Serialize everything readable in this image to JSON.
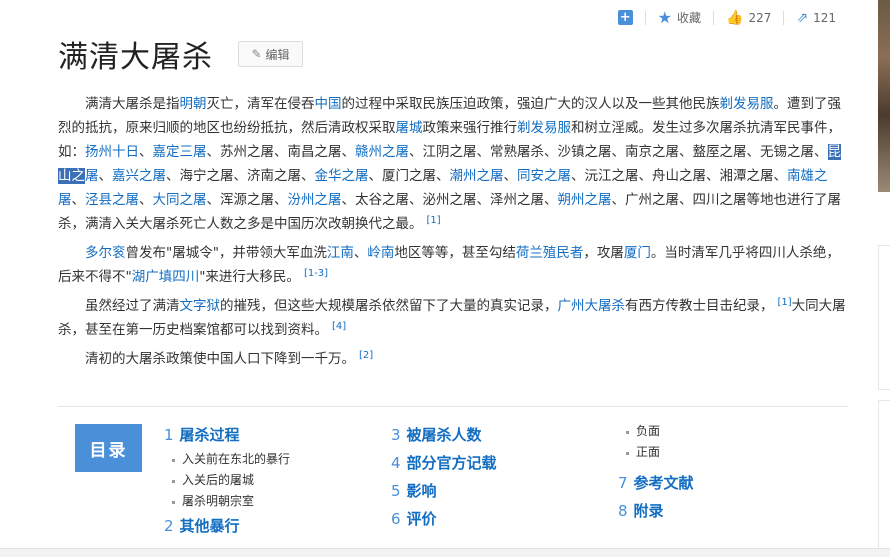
{
  "topbar": {
    "collect_label": "收藏",
    "like_count": "227",
    "share_count": "121"
  },
  "page": {
    "title": "满清大屠杀",
    "edit_label": "编辑"
  },
  "content": {
    "p1": [
      {
        "t": "满清大屠杀是指"
      },
      {
        "t": "明朝",
        "link": true
      },
      {
        "t": "灭亡，清军在侵吞"
      },
      {
        "t": "中国",
        "link": true
      },
      {
        "t": "的过程中采取民族压迫政策，强迫广大的汉人以及一些其他民族"
      },
      {
        "t": "剃发易服",
        "link": true
      },
      {
        "t": "。遭到了强烈的抵抗，原来归顺的地区也纷纷抵抗，然后清政权采取"
      },
      {
        "t": "屠城",
        "link": true
      },
      {
        "t": "政策来强行推行"
      },
      {
        "t": "剃发易服",
        "link": true
      },
      {
        "t": "和树立淫威。发生过多次屠杀抗清军民事件，如："
      },
      {
        "t": "扬州十日",
        "link": true
      },
      {
        "t": "、"
      },
      {
        "t": "嘉定三屠",
        "link": true
      },
      {
        "t": "、苏州之屠、南昌之屠、"
      },
      {
        "t": "赣州之屠",
        "link": true
      },
      {
        "t": "、江阴之屠、常熟屠杀、沙镇之屠、南京之屠、盩厔之屠、无锡之屠、"
      },
      {
        "t": "昆山之",
        "link": true,
        "hl": true
      },
      {
        "t": "屠",
        "link": true
      },
      {
        "t": "、"
      },
      {
        "t": "嘉兴之屠",
        "link": true
      },
      {
        "t": "、海宁之屠、济南之屠、"
      },
      {
        "t": "金华之屠",
        "link": true
      },
      {
        "t": "、厦门之屠、"
      },
      {
        "t": "潮州之屠",
        "link": true
      },
      {
        "t": "、"
      },
      {
        "t": "同安之屠",
        "link": true
      },
      {
        "t": "、沅江之屠、舟山之屠、湘潭之屠、"
      },
      {
        "t": "南雄之屠",
        "link": true
      },
      {
        "t": "、"
      },
      {
        "t": "泾县之屠",
        "link": true
      },
      {
        "t": "、"
      },
      {
        "t": "大同之屠",
        "link": true
      },
      {
        "t": "、浑源之屠、"
      },
      {
        "t": "汾州之屠",
        "link": true
      },
      {
        "t": "、太谷之屠、泌州之屠、泽州之屠、"
      },
      {
        "t": "朔州之屠",
        "link": true
      },
      {
        "t": "、广州之屠、四川之屠等地也进行了屠杀，满清入关大屠杀死亡人数之多是中国历次改朝换代之最。"
      },
      {
        "t": "[1]",
        "sup": true
      }
    ],
    "p2": [
      {
        "t": "多尔衮",
        "link": true
      },
      {
        "t": "曾发布\"屠城令\"，并带领大军血洗"
      },
      {
        "t": "江南",
        "link": true
      },
      {
        "t": "、"
      },
      {
        "t": "岭南",
        "link": true
      },
      {
        "t": "地区等等，甚至勾结"
      },
      {
        "t": "荷兰殖民者",
        "link": true
      },
      {
        "t": "，攻屠"
      },
      {
        "t": "厦门",
        "link": true
      },
      {
        "t": "。当时清军几乎将四川人杀绝，后来不得不\""
      },
      {
        "t": "湖广填四川",
        "link": true
      },
      {
        "t": "\"来进行大移民。"
      },
      {
        "t": "[1-3]",
        "sup": true
      }
    ],
    "p3": [
      {
        "t": "虽然经过了满清"
      },
      {
        "t": "文字狱",
        "link": true
      },
      {
        "t": "的摧残，但这些大规模屠杀依然留下了大量的真实记录，"
      },
      {
        "t": "广州大屠杀",
        "link": true
      },
      {
        "t": "有西方传教士目击纪录，"
      },
      {
        "t": "[1]",
        "sup": true
      },
      {
        "t": "大同大屠杀，甚至在第一历史档案馆都可以找到资料。"
      },
      {
        "t": "[4]",
        "sup": true
      }
    ],
    "p4": [
      {
        "t": "清初的大屠杀政策使中国人口下降到一千万。"
      },
      {
        "t": "[2]",
        "sup": true
      }
    ]
  },
  "toc": {
    "label": "目录",
    "col1": [
      {
        "num": "1",
        "label": "屠杀过程",
        "children": [
          "入关前在东北的暴行",
          "入关后的屠城",
          "屠杀明朝宗室"
        ]
      },
      {
        "num": "2",
        "label": "其他暴行",
        "children": []
      }
    ],
    "col2": [
      {
        "num": "3",
        "label": "被屠杀人数"
      },
      {
        "num": "4",
        "label": "部分官方记载"
      },
      {
        "num": "5",
        "label": "影响"
      },
      {
        "num": "6",
        "label": "评价"
      }
    ],
    "col3_sub": [
      "负面",
      "正面"
    ],
    "col3": [
      {
        "num": "7",
        "label": "参考文献"
      },
      {
        "num": "8",
        "label": "附录"
      }
    ]
  },
  "colors": {
    "link": "#136ec2",
    "accent": "#4a90d9",
    "highlight": "#3b6fb6"
  },
  "icons": [
    "plus-icon",
    "star-icon",
    "thumb-up-icon",
    "share-icon",
    "pencil-icon"
  ]
}
